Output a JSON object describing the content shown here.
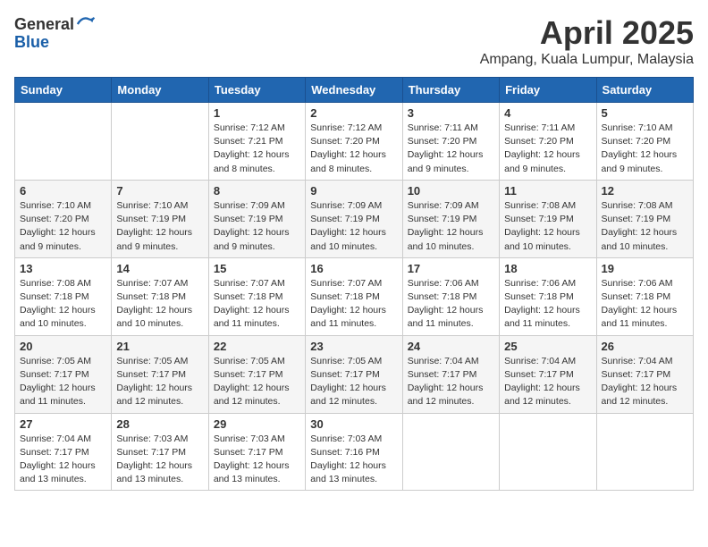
{
  "logo": {
    "general": "General",
    "blue": "Blue"
  },
  "header": {
    "month": "April 2025",
    "location": "Ampang, Kuala Lumpur, Malaysia"
  },
  "days_of_week": [
    "Sunday",
    "Monday",
    "Tuesday",
    "Wednesday",
    "Thursday",
    "Friday",
    "Saturday"
  ],
  "weeks": [
    [
      {
        "day": "",
        "info": ""
      },
      {
        "day": "",
        "info": ""
      },
      {
        "day": "1",
        "info": "Sunrise: 7:12 AM\nSunset: 7:21 PM\nDaylight: 12 hours and 8 minutes."
      },
      {
        "day": "2",
        "info": "Sunrise: 7:12 AM\nSunset: 7:20 PM\nDaylight: 12 hours and 8 minutes."
      },
      {
        "day": "3",
        "info": "Sunrise: 7:11 AM\nSunset: 7:20 PM\nDaylight: 12 hours and 9 minutes."
      },
      {
        "day": "4",
        "info": "Sunrise: 7:11 AM\nSunset: 7:20 PM\nDaylight: 12 hours and 9 minutes."
      },
      {
        "day": "5",
        "info": "Sunrise: 7:10 AM\nSunset: 7:20 PM\nDaylight: 12 hours and 9 minutes."
      }
    ],
    [
      {
        "day": "6",
        "info": "Sunrise: 7:10 AM\nSunset: 7:20 PM\nDaylight: 12 hours and 9 minutes."
      },
      {
        "day": "7",
        "info": "Sunrise: 7:10 AM\nSunset: 7:19 PM\nDaylight: 12 hours and 9 minutes."
      },
      {
        "day": "8",
        "info": "Sunrise: 7:09 AM\nSunset: 7:19 PM\nDaylight: 12 hours and 9 minutes."
      },
      {
        "day": "9",
        "info": "Sunrise: 7:09 AM\nSunset: 7:19 PM\nDaylight: 12 hours and 10 minutes."
      },
      {
        "day": "10",
        "info": "Sunrise: 7:09 AM\nSunset: 7:19 PM\nDaylight: 12 hours and 10 minutes."
      },
      {
        "day": "11",
        "info": "Sunrise: 7:08 AM\nSunset: 7:19 PM\nDaylight: 12 hours and 10 minutes."
      },
      {
        "day": "12",
        "info": "Sunrise: 7:08 AM\nSunset: 7:19 PM\nDaylight: 12 hours and 10 minutes."
      }
    ],
    [
      {
        "day": "13",
        "info": "Sunrise: 7:08 AM\nSunset: 7:18 PM\nDaylight: 12 hours and 10 minutes."
      },
      {
        "day": "14",
        "info": "Sunrise: 7:07 AM\nSunset: 7:18 PM\nDaylight: 12 hours and 10 minutes."
      },
      {
        "day": "15",
        "info": "Sunrise: 7:07 AM\nSunset: 7:18 PM\nDaylight: 12 hours and 11 minutes."
      },
      {
        "day": "16",
        "info": "Sunrise: 7:07 AM\nSunset: 7:18 PM\nDaylight: 12 hours and 11 minutes."
      },
      {
        "day": "17",
        "info": "Sunrise: 7:06 AM\nSunset: 7:18 PM\nDaylight: 12 hours and 11 minutes."
      },
      {
        "day": "18",
        "info": "Sunrise: 7:06 AM\nSunset: 7:18 PM\nDaylight: 12 hours and 11 minutes."
      },
      {
        "day": "19",
        "info": "Sunrise: 7:06 AM\nSunset: 7:18 PM\nDaylight: 12 hours and 11 minutes."
      }
    ],
    [
      {
        "day": "20",
        "info": "Sunrise: 7:05 AM\nSunset: 7:17 PM\nDaylight: 12 hours and 11 minutes."
      },
      {
        "day": "21",
        "info": "Sunrise: 7:05 AM\nSunset: 7:17 PM\nDaylight: 12 hours and 12 minutes."
      },
      {
        "day": "22",
        "info": "Sunrise: 7:05 AM\nSunset: 7:17 PM\nDaylight: 12 hours and 12 minutes."
      },
      {
        "day": "23",
        "info": "Sunrise: 7:05 AM\nSunset: 7:17 PM\nDaylight: 12 hours and 12 minutes."
      },
      {
        "day": "24",
        "info": "Sunrise: 7:04 AM\nSunset: 7:17 PM\nDaylight: 12 hours and 12 minutes."
      },
      {
        "day": "25",
        "info": "Sunrise: 7:04 AM\nSunset: 7:17 PM\nDaylight: 12 hours and 12 minutes."
      },
      {
        "day": "26",
        "info": "Sunrise: 7:04 AM\nSunset: 7:17 PM\nDaylight: 12 hours and 12 minutes."
      }
    ],
    [
      {
        "day": "27",
        "info": "Sunrise: 7:04 AM\nSunset: 7:17 PM\nDaylight: 12 hours and 13 minutes."
      },
      {
        "day": "28",
        "info": "Sunrise: 7:03 AM\nSunset: 7:17 PM\nDaylight: 12 hours and 13 minutes."
      },
      {
        "day": "29",
        "info": "Sunrise: 7:03 AM\nSunset: 7:17 PM\nDaylight: 12 hours and 13 minutes."
      },
      {
        "day": "30",
        "info": "Sunrise: 7:03 AM\nSunset: 7:16 PM\nDaylight: 12 hours and 13 minutes."
      },
      {
        "day": "",
        "info": ""
      },
      {
        "day": "",
        "info": ""
      },
      {
        "day": "",
        "info": ""
      }
    ]
  ]
}
